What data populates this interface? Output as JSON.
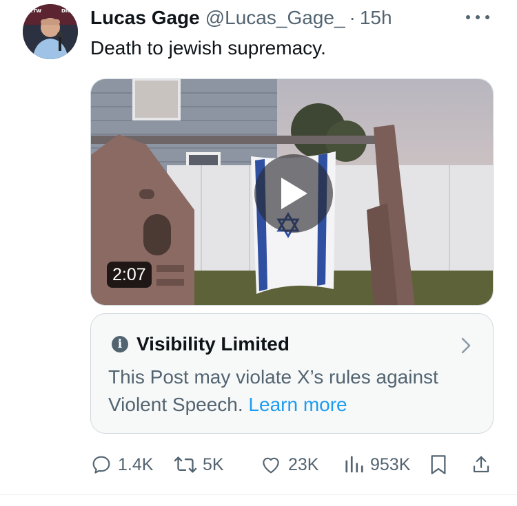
{
  "post": {
    "author_name": "Lucas Gage",
    "author_handle": "@Lucas_Gage_",
    "separator": "·",
    "time_ago": "15h",
    "text": "Death to jewish supremacy.",
    "video_duration": "2:07"
  },
  "notice": {
    "title": "Visibility Limited",
    "body": "This Post may violate X’s rules against Violent Speech.",
    "link": "Learn more"
  },
  "actions": {
    "replies": "1.4K",
    "reposts": "5K",
    "likes": "23K",
    "views": "953K"
  },
  "icons": {
    "more": "more-icon",
    "info": "info-icon",
    "chevron": "chevron-right-icon",
    "reply": "reply-icon",
    "repost": "repost-icon",
    "like": "heart-icon",
    "views": "views-icon",
    "bookmark": "bookmark-icon",
    "share": "share-icon"
  },
  "colors": {
    "text_primary": "#0f1419",
    "text_secondary": "#536471",
    "link": "#1d9bf0",
    "border": "#cfd9de"
  }
}
